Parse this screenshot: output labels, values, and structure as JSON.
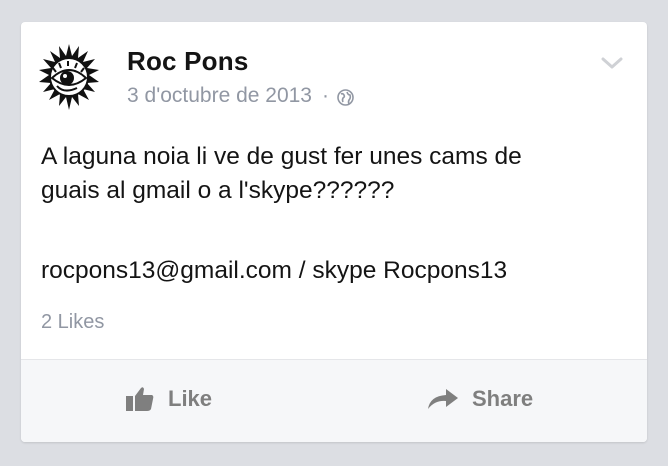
{
  "post": {
    "author": "Roc Pons",
    "date": "3 d'octubre de 2013",
    "separator": "·",
    "privacy_icon": "globe-icon",
    "menu_icon": "chevron-down-icon",
    "text_line1": "A laguna noia li ve de gust fer unes cams de",
    "text_line2": "guais al gmail o a l'skype??????",
    "contact": "rocpons13@gmail.com / skype Rocpons13",
    "likes": "2 Likes"
  },
  "actions": {
    "like_label": "Like",
    "like_icon": "thumbs-up-icon",
    "share_label": "Share",
    "share_icon": "share-arrow-icon"
  },
  "colors": {
    "background": "#dcdee3",
    "card": "#ffffff",
    "author": "#141414",
    "meta": "#9197a3",
    "action_text": "#7f7f7f",
    "action_bar": "#f6f7f9"
  }
}
